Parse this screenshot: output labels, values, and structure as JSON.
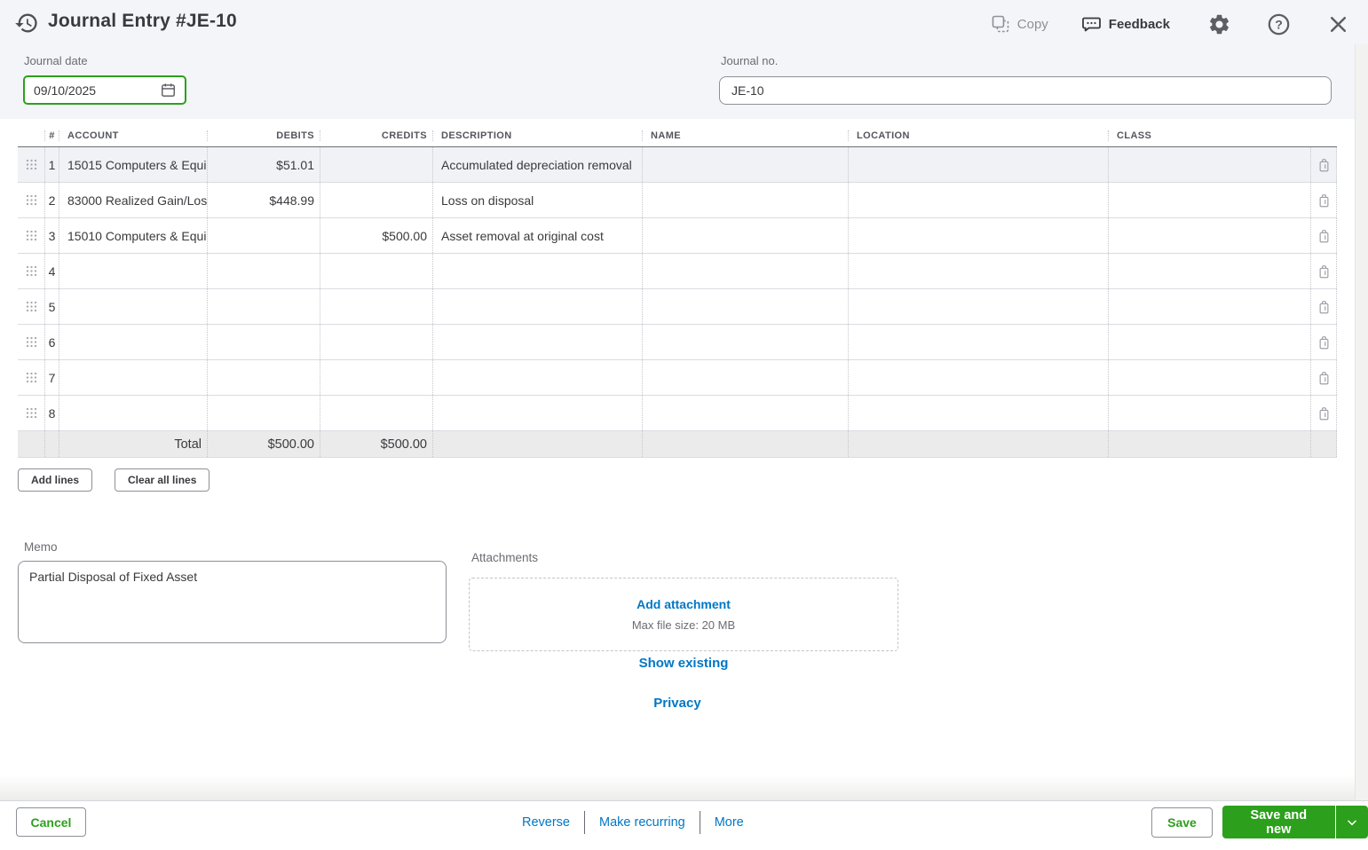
{
  "header": {
    "title": "Journal Entry #JE-10",
    "copy_label": "Copy",
    "feedback_label": "Feedback"
  },
  "form": {
    "journal_date": {
      "label": "Journal date",
      "value": "09/10/2025"
    },
    "journal_no": {
      "label": "Journal no.",
      "value": "JE-10"
    }
  },
  "table": {
    "columns": [
      "#",
      "ACCOUNT",
      "DEBITS",
      "CREDITS",
      "DESCRIPTION",
      "NAME",
      "LOCATION",
      "CLASS"
    ],
    "rows": [
      {
        "num": "1",
        "account": "15015 Computers & Equi",
        "debits": "$51.01",
        "credits": "",
        "description": "Accumulated depreciation removal",
        "name": "",
        "location": "",
        "class": ""
      },
      {
        "num": "2",
        "account": "83000 Realized Gain/Los",
        "debits": "$448.99",
        "credits": "",
        "description": "Loss on disposal",
        "name": "",
        "location": "",
        "class": ""
      },
      {
        "num": "3",
        "account": "15010 Computers & Equi",
        "debits": "",
        "credits": "$500.00",
        "description": "Asset removal at original cost",
        "name": "",
        "location": "",
        "class": ""
      },
      {
        "num": "4",
        "account": "",
        "debits": "",
        "credits": "",
        "description": "",
        "name": "",
        "location": "",
        "class": ""
      },
      {
        "num": "5",
        "account": "",
        "debits": "",
        "credits": "",
        "description": "",
        "name": "",
        "location": "",
        "class": ""
      },
      {
        "num": "6",
        "account": "",
        "debits": "",
        "credits": "",
        "description": "",
        "name": "",
        "location": "",
        "class": ""
      },
      {
        "num": "7",
        "account": "",
        "debits": "",
        "credits": "",
        "description": "",
        "name": "",
        "location": "",
        "class": ""
      },
      {
        "num": "8",
        "account": "",
        "debits": "",
        "credits": "",
        "description": "",
        "name": "",
        "location": "",
        "class": ""
      }
    ],
    "total": {
      "label": "Total",
      "debits": "$500.00",
      "credits": "$500.00"
    }
  },
  "line_buttons": {
    "add_lines": "Add lines",
    "clear_all_lines": "Clear all lines"
  },
  "memo": {
    "label": "Memo",
    "value": "Partial Disposal of Fixed Asset"
  },
  "attachments": {
    "label": "Attachments",
    "add_label": "Add attachment",
    "max_size": "Max file size: 20 MB",
    "show_existing": "Show existing",
    "privacy": "Privacy"
  },
  "footer": {
    "cancel": "Cancel",
    "reverse": "Reverse",
    "make_recurring": "Make recurring",
    "more": "More",
    "save": "Save",
    "save_and_new": "Save and new"
  },
  "colors": {
    "accent_green": "#2ca01c",
    "link_blue": "#0077c5"
  },
  "icons": [
    "history-icon",
    "copy-icon",
    "feedback-icon",
    "gear-icon",
    "help-icon",
    "close-icon",
    "calendar-icon",
    "drag-handle-icon",
    "trash-icon",
    "chevron-down-icon"
  ]
}
